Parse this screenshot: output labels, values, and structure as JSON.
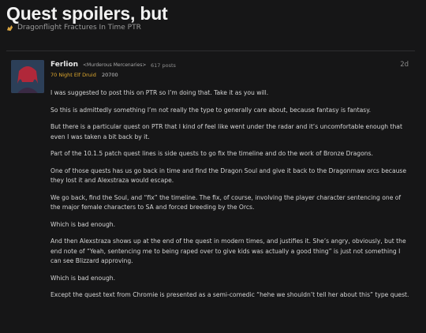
{
  "topic": {
    "title": "Quest spoilers, but",
    "category": "Dragonflight Fractures In Time PTR"
  },
  "post": {
    "username": "Ferlion",
    "guild": "<Murderous Mercenaries>",
    "post_count": "617 posts",
    "character": "70 Night Elf Druid",
    "achievement_points": "20700",
    "date": "2d",
    "paragraphs": [
      "I was suggested to post this on PTR so I’m doing that. Take it as you will.",
      "So this is admittedly something I’m not really the type to generally care about, because fantasy is fantasy.",
      "But there is a particular quest on PTR that I kind of feel like went under the radar and it’s uncomfortable enough that even I was taken a bit back by it.",
      "Part of the 10.1.5 patch quest lines is side quests to go fix the timeline and do the work of Bronze Dragons.",
      "One of those quests has us go back in time and find the Dragon Soul and give it back to the Dragonmaw orcs because they lost it and Alexstraza would escape.",
      "We go back, find the Soul, and “fix” the timeline. The fix, of course, involving the player character sentencing one of the major female characters to SA and forced breeding by the Orcs.",
      "Which is bad enough.",
      "And then Alexstraza shows up at the end of the quest in modern times, and justifies it. She’s angry, obviously, but the end note of “Yeah, sentencing me to being raped over to give kids was actually a good thing” is just not something I can see Blizzard approving.",
      "Which is bad enough.",
      "Except the quest text from Chromie is presented as a semi-comedic “hehe we shouldn’t tell her about this” type quest."
    ]
  },
  "colors": {
    "background": "#161617",
    "class_color": "#e0a92e"
  },
  "icons": {
    "category": "dragon-icon"
  }
}
